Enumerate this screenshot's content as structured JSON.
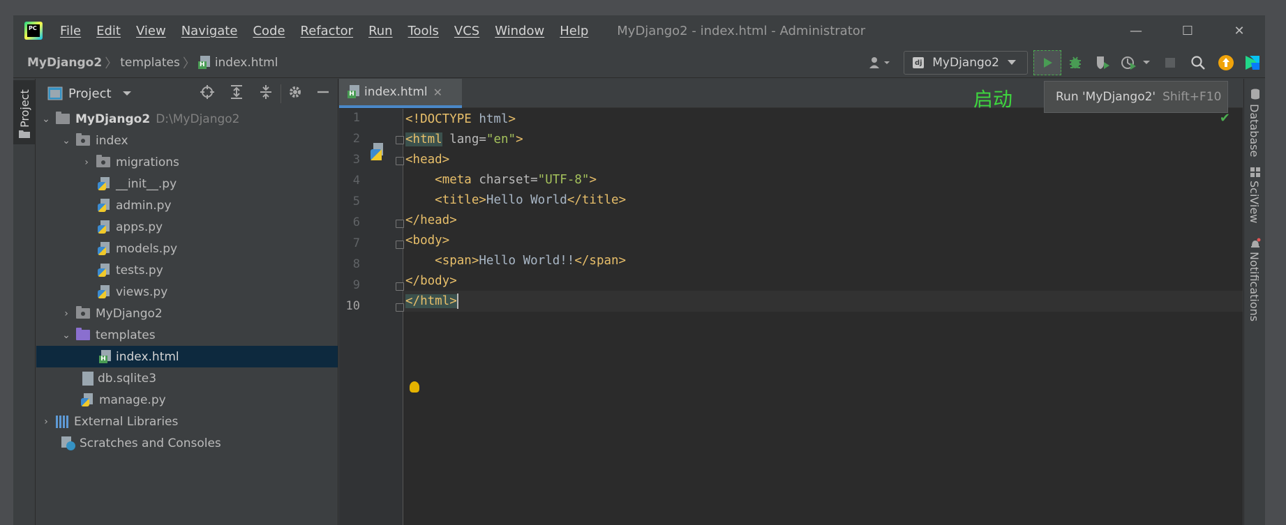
{
  "titlebar": {
    "menu": [
      "File",
      "Edit",
      "View",
      "Navigate",
      "Code",
      "Refactor",
      "Run",
      "Tools",
      "VCS",
      "Window",
      "Help"
    ],
    "window_title": "MyDjango2 - index.html - Administrator",
    "controls": {
      "minimize": "—",
      "maximize": "☐",
      "close": "✕"
    }
  },
  "navbar": {
    "breadcrumbs": [
      "MyDjango2",
      "templates",
      "index.html"
    ],
    "run_config": "MyDjango2",
    "icons": [
      "user-icon",
      "run-icon",
      "debug-icon",
      "coverage-icon",
      "profile-icon",
      "stop-icon",
      "search-icon",
      "update-icon",
      "toolbox-icon"
    ]
  },
  "left_stripe": {
    "tab_label": "Project"
  },
  "project_panel": {
    "title": "Project",
    "tree": [
      {
        "label": "MyDjango2",
        "hint": "D:\\MyDjango2",
        "level": 0,
        "type": "folder",
        "expanded": true
      },
      {
        "label": "index",
        "level": 1,
        "type": "package",
        "expanded": true
      },
      {
        "label": "migrations",
        "level": 2,
        "type": "package",
        "expanded": false
      },
      {
        "label": "__init__.py",
        "level": 2,
        "type": "python"
      },
      {
        "label": "admin.py",
        "level": 2,
        "type": "python"
      },
      {
        "label": "apps.py",
        "level": 2,
        "type": "python"
      },
      {
        "label": "models.py",
        "level": 2,
        "type": "python"
      },
      {
        "label": "tests.py",
        "level": 2,
        "type": "python"
      },
      {
        "label": "views.py",
        "level": 2,
        "type": "python"
      },
      {
        "label": "MyDjango2",
        "level": 1,
        "type": "package",
        "expanded": false
      },
      {
        "label": "templates",
        "level": 1,
        "type": "templates",
        "expanded": true
      },
      {
        "label": "index.html",
        "level": 2,
        "type": "html",
        "selected": true
      },
      {
        "label": "db.sqlite3",
        "level": 1,
        "type": "db"
      },
      {
        "label": "manage.py",
        "level": 1,
        "type": "python"
      },
      {
        "label": "External Libraries",
        "level": 0,
        "type": "libraries",
        "expanded": false
      },
      {
        "label": "Scratches and Consoles",
        "level": 0,
        "type": "scratches"
      }
    ]
  },
  "editor": {
    "tab": {
      "label": "index.html",
      "close": "✕"
    },
    "annotation": "启动",
    "tooltip": {
      "text": "Run 'MyDjango2'",
      "shortcut": "Shift+F10"
    },
    "current_line": 10,
    "lines": [
      [
        {
          "c": "tg",
          "t": "<!DOCTYPE "
        },
        {
          "c": "tx",
          "t": "html"
        },
        {
          "c": "tg",
          "t": ">"
        }
      ],
      [
        {
          "c": "tg hl",
          "t": "<html"
        },
        {
          "c": "at",
          "t": " lang="
        },
        {
          "c": "av",
          "t": "\"en\""
        },
        {
          "c": "tg",
          "t": ">"
        }
      ],
      [
        {
          "c": "tg",
          "t": "<head>"
        }
      ],
      [
        {
          "c": "tx",
          "t": "    "
        },
        {
          "c": "tg",
          "t": "<meta "
        },
        {
          "c": "at",
          "t": "charset="
        },
        {
          "c": "av",
          "t": "\"UTF-8\""
        },
        {
          "c": "tg",
          "t": ">"
        }
      ],
      [
        {
          "c": "tx",
          "t": "    "
        },
        {
          "c": "tg",
          "t": "<title>"
        },
        {
          "c": "tx",
          "t": "Hello World"
        },
        {
          "c": "tg",
          "t": "</title>"
        }
      ],
      [
        {
          "c": "tg",
          "t": "</head>"
        }
      ],
      [
        {
          "c": "tg",
          "t": "<body>"
        }
      ],
      [
        {
          "c": "tx",
          "t": "    "
        },
        {
          "c": "tg",
          "t": "<span>"
        },
        {
          "c": "tx",
          "t": "Hello World!!"
        },
        {
          "c": "tg",
          "t": "</span>"
        }
      ],
      [
        {
          "c": "tg",
          "t": "</body>"
        }
      ],
      [
        {
          "c": "tg hl",
          "t": "</html>"
        }
      ]
    ]
  },
  "right_stripe": {
    "labels": [
      "Database",
      "SciView",
      "Notifications"
    ]
  },
  "colors": {
    "accent": "#4a88c7",
    "run_green": "#3ed63e",
    "selection": "#0d293e",
    "editor_bg": "#2b2b2b"
  }
}
